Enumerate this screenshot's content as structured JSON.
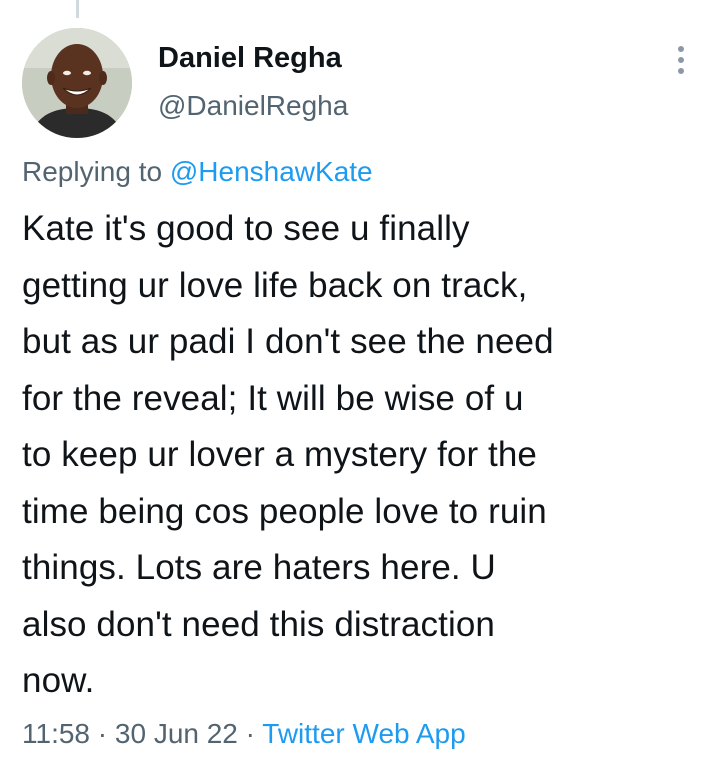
{
  "author": {
    "name": "Daniel Regha",
    "handle": "@DanielRegha"
  },
  "reply": {
    "prefix": "Replying to",
    "mention": "@HenshawKate"
  },
  "tweet": {
    "lines": [
      "Kate it's good to see u finally",
      "getting ur love life back on track,",
      "but as ur padi I don't see the need",
      "for the reveal; It will be wise of u",
      "to keep ur lover a mystery for the",
      "time being cos people love to ruin",
      "things. Lots are haters here. U",
      "also don't need this distraction",
      "now."
    ]
  },
  "meta": {
    "time": "11:58",
    "separator": "·",
    "date": "30 Jun 22",
    "source": "Twitter Web App"
  },
  "icons": {
    "more": "more-vertical-icon",
    "avatar": "avatar-photo"
  },
  "colors": {
    "link": "#1d9bf0",
    "secondary_text": "#536471",
    "primary_text": "#0f1419",
    "background": "#ffffff"
  }
}
